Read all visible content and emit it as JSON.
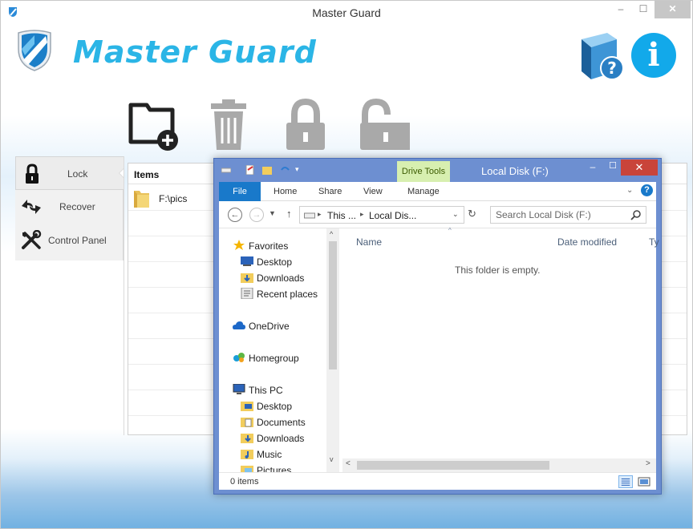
{
  "app": {
    "title": "Master Guard",
    "brand_text": "Master Guard",
    "window_controls": {
      "minimize": "–",
      "maximize": "☐",
      "close": "✕"
    }
  },
  "toolbar": {
    "items": [
      {
        "name": "add-folder",
        "icon": "folder-plus-icon"
      },
      {
        "name": "delete",
        "icon": "trash-icon"
      },
      {
        "name": "lock",
        "icon": "lock-icon"
      },
      {
        "name": "unlock",
        "icon": "unlock-icon"
      }
    ]
  },
  "sidebar": {
    "items": [
      {
        "label": "Lock",
        "icon": "lock-icon"
      },
      {
        "label": "Recover",
        "icon": "recover-arrows-icon"
      },
      {
        "label": "Control Panel",
        "icon": "tools-icon"
      }
    ]
  },
  "table": {
    "header": "Items",
    "rows": [
      {
        "path": "F:\\pics",
        "icon": "folder-icon"
      }
    ]
  },
  "explorer": {
    "title": "Local Disk (F:)",
    "context_tab": "Drive Tools",
    "ribbon_tabs": [
      "File",
      "Home",
      "Share",
      "View",
      "Manage"
    ],
    "window_controls": {
      "minimize": "–",
      "maximize": "☐",
      "close": "✕"
    },
    "address": {
      "crumb1": "This ...",
      "crumb2": "Local Dis..."
    },
    "search_placeholder": "Search Local Disk (F:)",
    "nav": [
      {
        "label": "Favorites",
        "icon": "star-icon"
      },
      {
        "label": "Desktop",
        "icon": "desktop-icon"
      },
      {
        "label": "Downloads",
        "icon": "downloads-folder-icon"
      },
      {
        "label": "Recent places",
        "icon": "recent-places-icon"
      },
      {
        "label": "OneDrive",
        "icon": "onedrive-icon"
      },
      {
        "label": "Homegroup",
        "icon": "homegroup-icon"
      },
      {
        "label": "This PC",
        "icon": "computer-icon"
      },
      {
        "label": "Desktop",
        "icon": "desktop-folder-icon"
      },
      {
        "label": "Documents",
        "icon": "documents-folder-icon"
      },
      {
        "label": "Downloads",
        "icon": "downloads-folder-icon"
      },
      {
        "label": "Music",
        "icon": "music-folder-icon"
      },
      {
        "label": "Pictures",
        "icon": "pictures-folder-icon"
      }
    ],
    "columns": [
      "Name",
      "Date modified",
      "Ty"
    ],
    "empty_message": "This folder is empty.",
    "status": "0 items",
    "colors": {
      "frame": "#6d8fd1",
      "file_tab": "#1979ca",
      "drive_tools": "#d7efb0",
      "close": "#c9443a"
    }
  },
  "colors": {
    "brand": "#2bb5e6",
    "info": "#12a9ea"
  }
}
